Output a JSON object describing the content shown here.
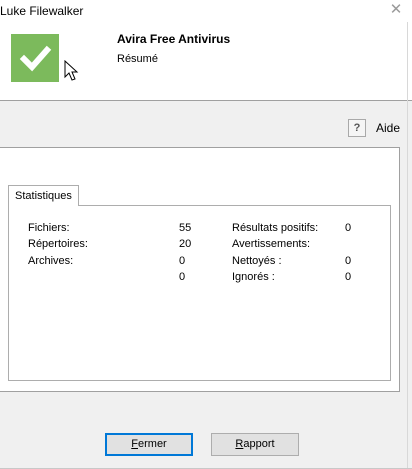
{
  "window": {
    "title": "Luke Filewalker"
  },
  "header": {
    "product": "Avira Free Antivirus",
    "subtitle": "Résumé"
  },
  "help": {
    "icon_glyph": "?",
    "label": "Aide"
  },
  "tabs": [
    {
      "label": "Statistiques",
      "selected": true
    }
  ],
  "stats": {
    "files_label": "Fichiers:",
    "files_value": "55",
    "dirs_label": "Répertoires:",
    "dirs_value": "20",
    "archives_label": "Archives:",
    "archives_value": "0",
    "unlabeled_value": "0",
    "positives_label": "Résultats positifs:",
    "positives_value": "0",
    "warnings_label": "Avertissements:",
    "cleaned_label": "Nettoyés :",
    "cleaned_value": "0",
    "ignored_label": "Ignorés :",
    "ignored_value": "0"
  },
  "buttons": {
    "close_label": "Fermer",
    "close_mnemonic": "F",
    "report_label": "Rapport",
    "report_mnemonic": "R"
  },
  "colors": {
    "logo_green": "#7cba5c",
    "focus_blue": "#0078d7"
  },
  "icons": {
    "logo": "checkmark-icon",
    "help": "help-icon",
    "close": "close-icon",
    "cursor": "mouse-pointer-icon"
  }
}
